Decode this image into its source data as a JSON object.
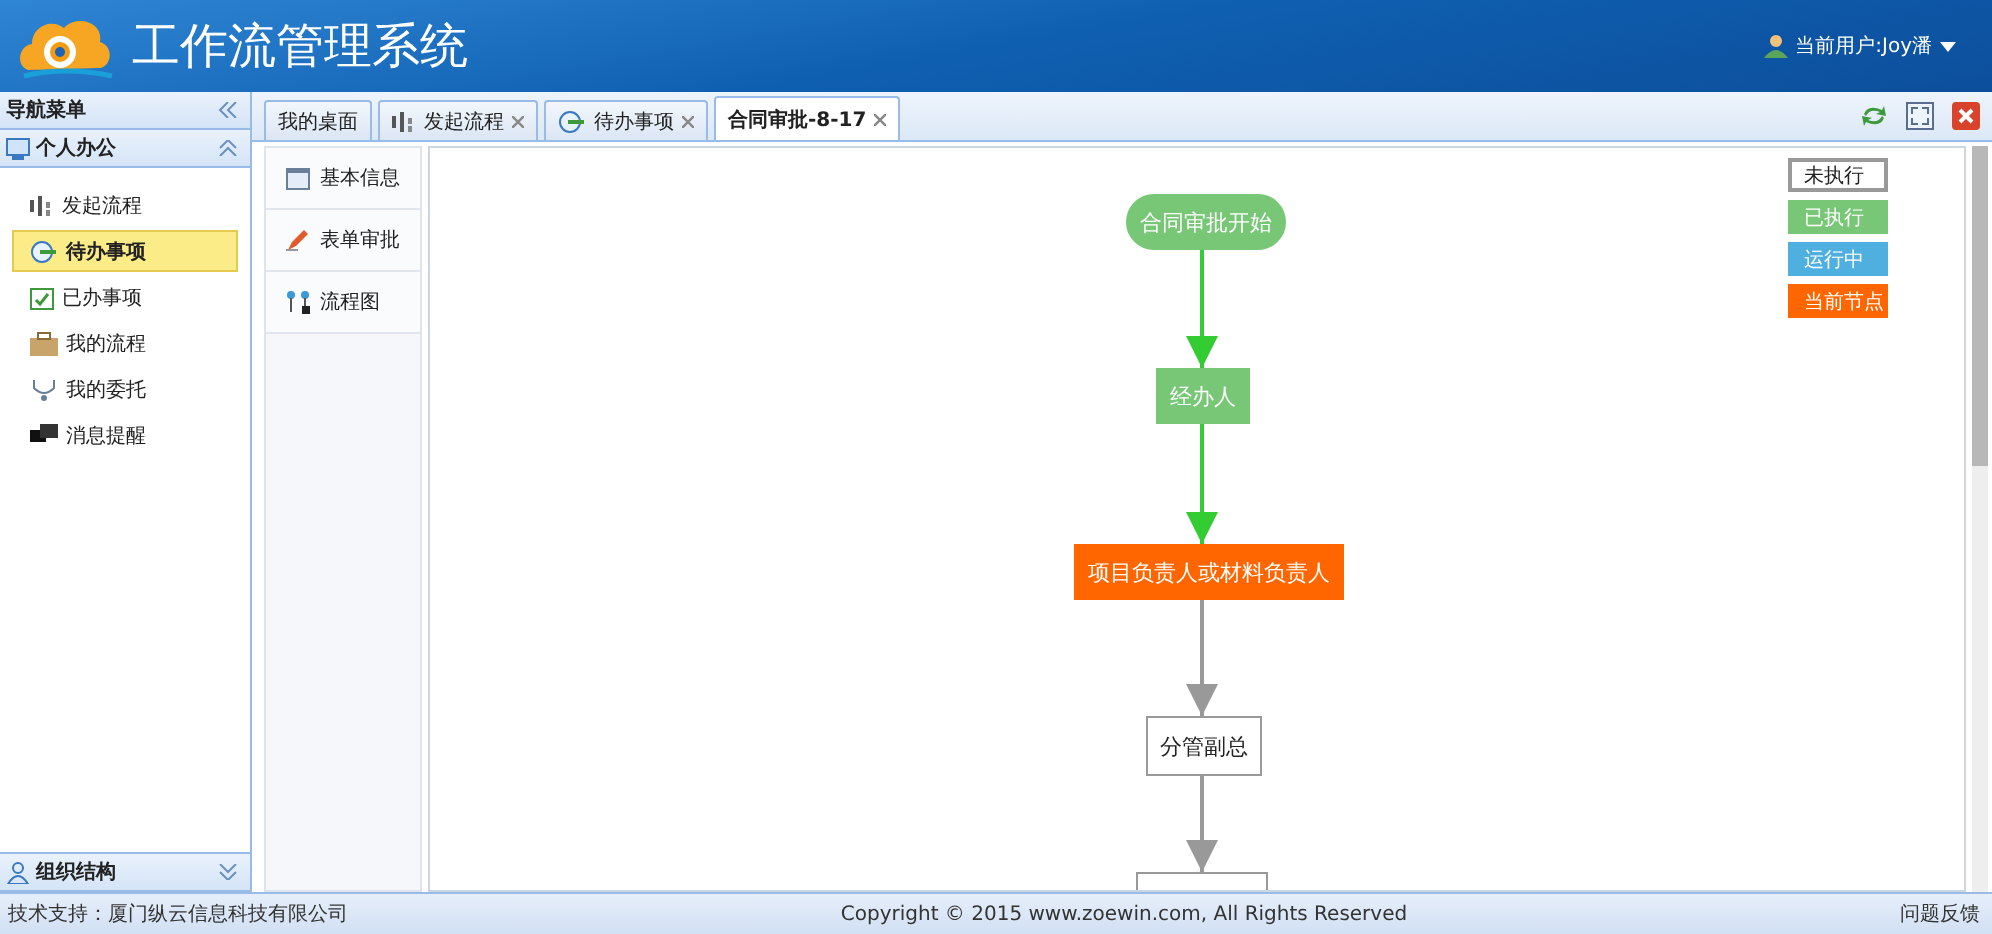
{
  "header": {
    "title": "工作流管理系统",
    "user": "当前用户:Joy潘"
  },
  "sidebar": {
    "title": "导航菜单",
    "section": "个人办公",
    "items": [
      {
        "label": "发起流程",
        "kind": "flow",
        "selected": false
      },
      {
        "label": "待办事项",
        "kind": "pending",
        "selected": true
      },
      {
        "label": "已办事项",
        "kind": "done",
        "selected": false
      },
      {
        "label": "我的流程",
        "kind": "briefcase",
        "selected": false
      },
      {
        "label": "我的委托",
        "kind": "delegate",
        "selected": false
      },
      {
        "label": "消息提醒",
        "kind": "message",
        "selected": false
      }
    ],
    "bottom_section": "组织结构"
  },
  "tabs": [
    {
      "label": "我的桌面",
      "kind": "plain",
      "closable": false,
      "selected": false
    },
    {
      "label": "发起流程",
      "kind": "flow",
      "closable": true,
      "selected": false
    },
    {
      "label": "待办事项",
      "kind": "pending",
      "closable": true,
      "selected": false
    },
    {
      "label": "合同审批-8-17",
      "kind": "plain",
      "closable": true,
      "selected": true
    }
  ],
  "detail_nav": [
    {
      "label": "基本信息",
      "kind": "info"
    },
    {
      "label": "表单审批",
      "kind": "edit"
    },
    {
      "label": "流程图",
      "kind": "chart"
    }
  ],
  "legend": [
    {
      "label": "未执行",
      "color": "#ffffff"
    },
    {
      "label": "已执行",
      "color": "#77c777"
    },
    {
      "label": "运行中",
      "color": "#4fb0e0"
    },
    {
      "label": "当前节点",
      "color": "#ff6600"
    }
  ],
  "nodes": [
    {
      "kind": "start",
      "label": "合同审批开始",
      "color": "#77c777"
    },
    {
      "kind": "task",
      "label": "经办人",
      "color": "#77c777"
    },
    {
      "kind": "task",
      "label": "项目负责人或材料负责人",
      "color": "#ff6600"
    },
    {
      "kind": "task",
      "label": "分管副总",
      "color": "#ffffff"
    },
    {
      "kind": "task",
      "color": "#ffffff"
    }
  ],
  "footer": {
    "support": "技术支持：厦门纵云信息科技有限公司",
    "copyright": "Copyright © 2015 www.zoewin.com, All Rights Reserved",
    "feedback": "问题反馈"
  }
}
